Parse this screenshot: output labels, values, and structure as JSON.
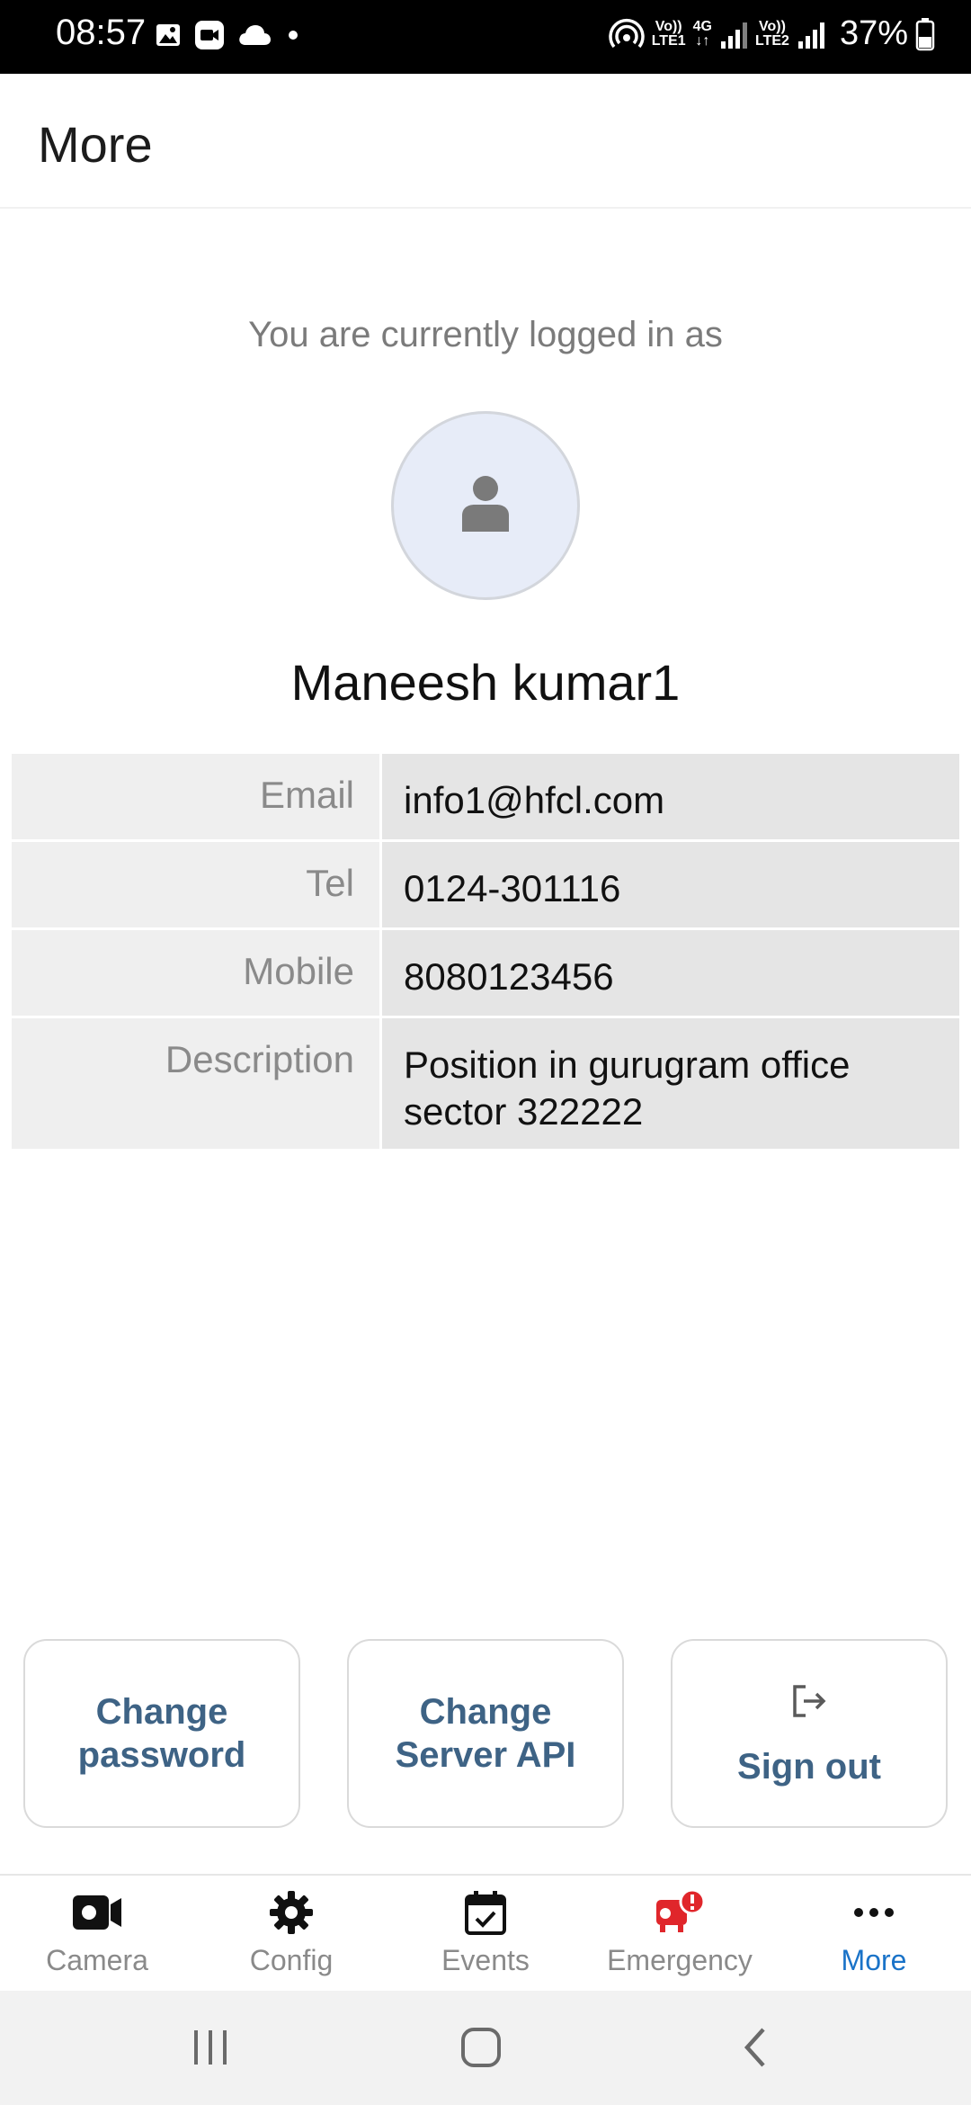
{
  "status_bar": {
    "time": "08:57",
    "net_label_1_top": "Vo))",
    "net_label_1_bottom": "LTE1",
    "net_label_4g_top": "4G",
    "net_label_4g_bottom": "↓↑",
    "net_label_2_top": "Vo))",
    "net_label_2_bottom": "LTE2",
    "battery": "37%"
  },
  "header": {
    "title": "More"
  },
  "profile": {
    "logged_in_text": "You are currently logged in as",
    "name": "Maneesh kumar1"
  },
  "details": [
    {
      "key": "Email",
      "value": "info1@hfcl.com"
    },
    {
      "key": "Tel",
      "value": "0124-301116"
    },
    {
      "key": "Mobile",
      "value": "8080123456"
    },
    {
      "key": "Description",
      "value_line1": "Position in gurugram office",
      "value_line2": "sector 322222"
    }
  ],
  "actions": {
    "change_password_line1": "Change",
    "change_password_line2": "password",
    "change_server_line1": "Change",
    "change_server_line2": "Server API",
    "sign_out": "Sign out"
  },
  "bottom_nav": [
    {
      "label": "Camera",
      "icon": "camera-icon"
    },
    {
      "label": "Config",
      "icon": "gear-icon"
    },
    {
      "label": "Events",
      "icon": "calendar-check-icon"
    },
    {
      "label": "Emergency",
      "icon": "emergency-alert-icon"
    },
    {
      "label": "More",
      "icon": "more-dots-icon",
      "active": true
    }
  ],
  "colors": {
    "accent": "#1a73c8",
    "button_text": "#3e6385",
    "emergency": "#e0262b"
  }
}
